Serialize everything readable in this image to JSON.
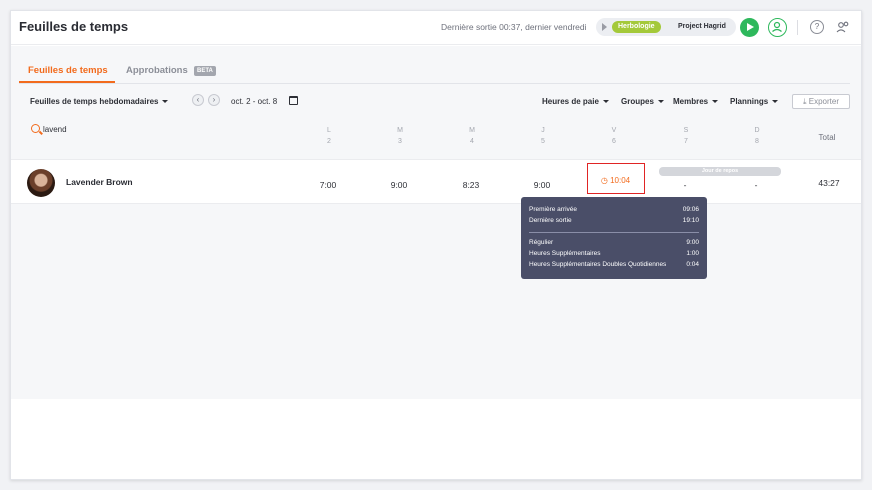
{
  "app": {
    "title": "Feuilles de temps"
  },
  "topbar": {
    "last_out": "Dernière sortie 00:37, dernier vendredi",
    "job_tag": "Herbologie",
    "project_tag": "Project Hagrid",
    "job_tag_color": "#a4c93a",
    "play_color": "#2eb85c",
    "help_label": "?"
  },
  "tabs": [
    {
      "label": "Feuilles de temps",
      "active": true
    },
    {
      "label": "Approbations",
      "active": false,
      "badge": "BETA"
    }
  ],
  "filters": {
    "view_select": "Feuilles de temps hebdomadaires",
    "prev_label": "‹",
    "next_label": "›",
    "date_range": "oct. 2 - oct. 8",
    "pay_hours": "Heures de paie",
    "groups": "Groupes",
    "members": "Membres",
    "schedules": "Plannings",
    "export": "Exporter",
    "export_icon": "download-icon"
  },
  "search": {
    "value": "lavend",
    "placeholder": ""
  },
  "days": [
    {
      "letter": "L",
      "num": "2"
    },
    {
      "letter": "M",
      "num": "3"
    },
    {
      "letter": "M",
      "num": "4"
    },
    {
      "letter": "J",
      "num": "5"
    },
    {
      "letter": "V",
      "num": "6"
    },
    {
      "letter": "S",
      "num": "7"
    },
    {
      "letter": "D",
      "num": "8"
    }
  ],
  "total_header": "Total",
  "employee": {
    "name": "Lavender Brown",
    "cells": [
      "7:00",
      "9:00",
      "8:23",
      "9:00",
      "10:04",
      "-",
      "-"
    ],
    "alert_icon": "◷",
    "rest_day_label": "Jour de repos",
    "total": "43:27"
  },
  "tooltip": {
    "rows_top": [
      {
        "label": "Première arrivée",
        "value": "09:06"
      },
      {
        "label": "Dernière sortie",
        "value": "19:10"
      }
    ],
    "rows_bottom": [
      {
        "label": "Régulier",
        "value": "9:00"
      },
      {
        "label": "Heures Supplémentaires",
        "value": "1:00"
      },
      {
        "label": "Heures Supplémentaires Doubles Quotidiennes",
        "value": "0:04"
      }
    ]
  },
  "colors": {
    "accent": "#f26b1d",
    "alert_border": "#e02424",
    "tooltip_bg": "#4a4e68"
  }
}
